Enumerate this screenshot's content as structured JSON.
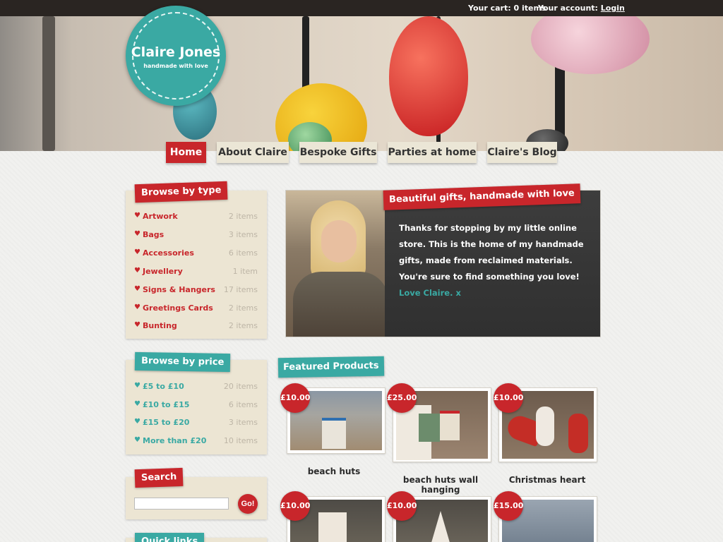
{
  "topbar": {
    "cart_label": "Your cart:",
    "cart_value": "0 items",
    "account_label": "Your account:",
    "account_link": "Login"
  },
  "logo": {
    "title": "Claire Jones",
    "tagline": "handmade with love"
  },
  "nav": [
    {
      "label": "Home",
      "active": true
    },
    {
      "label": "About Claire"
    },
    {
      "label": "Bespoke Gifts"
    },
    {
      "label": "Parties at home"
    },
    {
      "label": "Claire's Blog"
    }
  ],
  "browse_type": {
    "title": "Browse by type",
    "items": [
      {
        "label": "Artwork",
        "count": "2 items"
      },
      {
        "label": "Bags",
        "count": "3 items"
      },
      {
        "label": "Accessories",
        "count": "6 items"
      },
      {
        "label": "Jewellery",
        "count": "1 item"
      },
      {
        "label": "Signs & Hangers",
        "count": "17 items"
      },
      {
        "label": "Greetings Cards",
        "count": "2 items"
      },
      {
        "label": "Bunting",
        "count": "2 items"
      }
    ]
  },
  "browse_price": {
    "title": "Browse by price",
    "items": [
      {
        "label": "£5 to £10",
        "count": "20 items"
      },
      {
        "label": "£10 to £15",
        "count": "6 items"
      },
      {
        "label": "£15 to £20",
        "count": "3 items"
      },
      {
        "label": "More than £20",
        "count": "10 items"
      }
    ]
  },
  "search": {
    "title": "Search",
    "placeholder": "",
    "button": "Go!"
  },
  "quicklinks": {
    "title": "Quick links"
  },
  "welcome": {
    "title": "Beautiful gifts, handmade with love",
    "body": "Thanks for stopping by my little online store. This is the home of my handmade gifts, made from reclaimed materials. You're sure to find something you love!",
    "signoff": "Love Claire. x"
  },
  "featured": {
    "title": "Featured Products",
    "products": [
      {
        "name": "beach huts",
        "price": "£10.00"
      },
      {
        "name": "beach huts wall hanging",
        "price": "£25.00"
      },
      {
        "name": "Christmas heart",
        "price": "£10.00"
      },
      {
        "name": "",
        "price": "£10.00"
      },
      {
        "name": "",
        "price": "£10.00"
      },
      {
        "name": "",
        "price": "£15.00"
      }
    ]
  },
  "colors": {
    "red": "#c8262b",
    "teal": "#3aa9a3",
    "cream": "#ece5d3",
    "topbar": "#2a2522"
  }
}
